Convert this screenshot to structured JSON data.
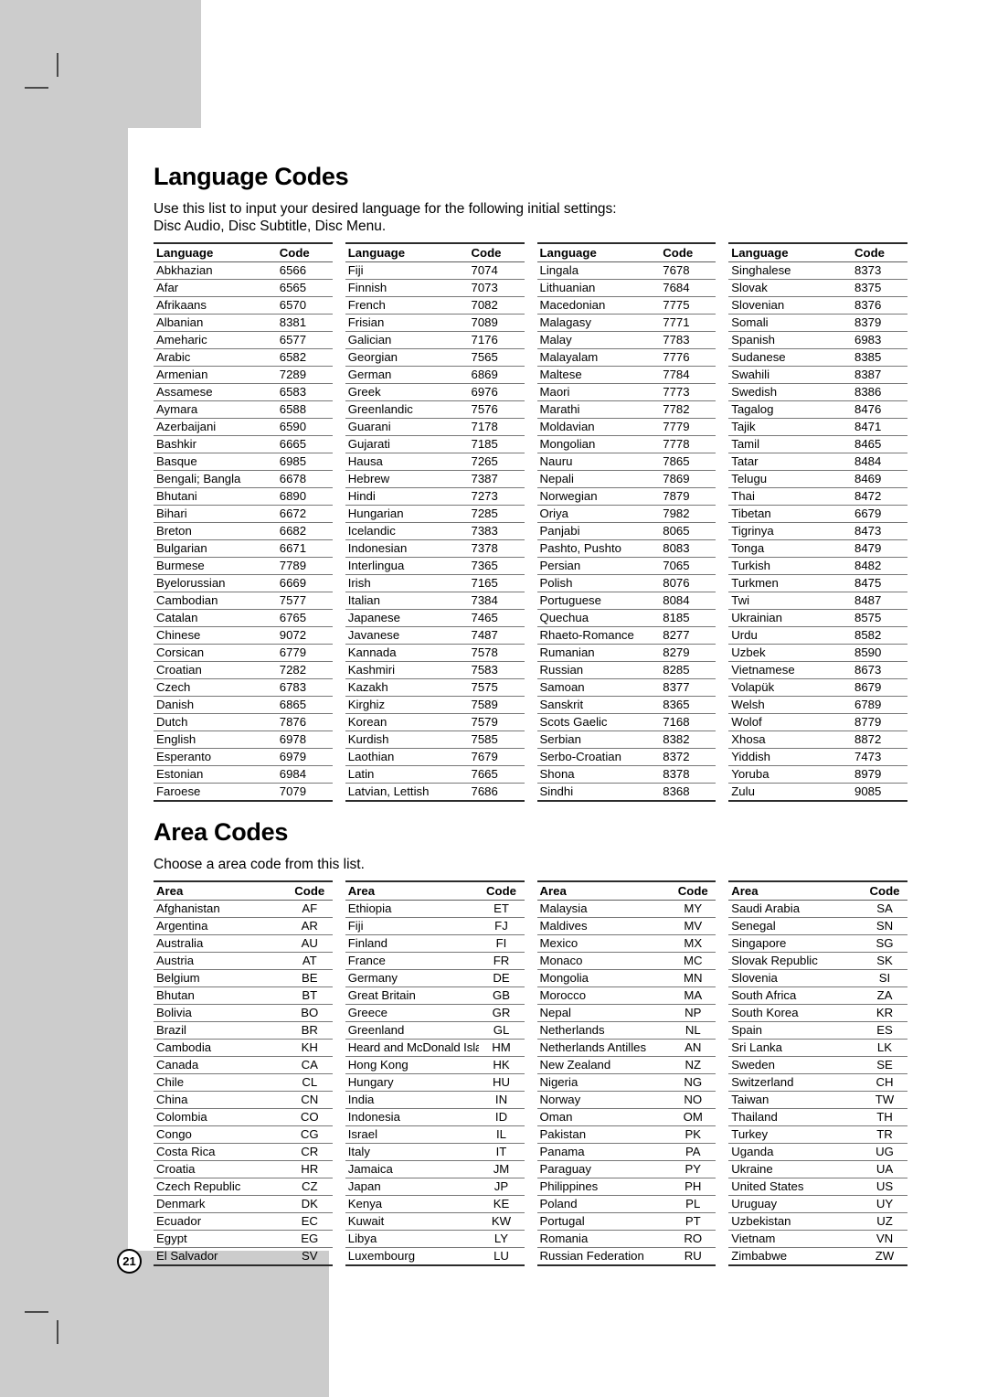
{
  "page": {
    "number": "21"
  },
  "language_section": {
    "title": "Language Codes",
    "intro_line1": "Use this list to input your desired language for the following initial settings:",
    "intro_line2": "Disc Audio, Disc Subtitle, Disc Menu.",
    "headers": {
      "name": "Language",
      "code": "Code"
    },
    "columns": [
      [
        [
          "Abkhazian",
          "6566"
        ],
        [
          "Afar",
          "6565"
        ],
        [
          "Afrikaans",
          "6570"
        ],
        [
          "Albanian",
          "8381"
        ],
        [
          "Ameharic",
          "6577"
        ],
        [
          "Arabic",
          "6582"
        ],
        [
          "Armenian",
          "7289"
        ],
        [
          "Assamese",
          "6583"
        ],
        [
          "Aymara",
          "6588"
        ],
        [
          "Azerbaijani",
          "6590"
        ],
        [
          "Bashkir",
          "6665"
        ],
        [
          "Basque",
          "6985"
        ],
        [
          "Bengali; Bangla",
          "6678"
        ],
        [
          "Bhutani",
          "6890"
        ],
        [
          "Bihari",
          "6672"
        ],
        [
          "Breton",
          "6682"
        ],
        [
          "Bulgarian",
          "6671"
        ],
        [
          "Burmese",
          "7789"
        ],
        [
          "Byelorussian",
          "6669"
        ],
        [
          "Cambodian",
          "7577"
        ],
        [
          "Catalan",
          "6765"
        ],
        [
          "Chinese",
          "9072"
        ],
        [
          "Corsican",
          "6779"
        ],
        [
          "Croatian",
          "7282"
        ],
        [
          "Czech",
          "6783"
        ],
        [
          "Danish",
          "6865"
        ],
        [
          "Dutch",
          "7876"
        ],
        [
          "English",
          "6978"
        ],
        [
          "Esperanto",
          "6979"
        ],
        [
          "Estonian",
          "6984"
        ],
        [
          "Faroese",
          "7079"
        ]
      ],
      [
        [
          "Fiji",
          "7074"
        ],
        [
          "Finnish",
          "7073"
        ],
        [
          "French",
          "7082"
        ],
        [
          "Frisian",
          "7089"
        ],
        [
          "Galician",
          "7176"
        ],
        [
          "Georgian",
          "7565"
        ],
        [
          "German",
          "6869"
        ],
        [
          "Greek",
          "6976"
        ],
        [
          "Greenlandic",
          "7576"
        ],
        [
          "Guarani",
          "7178"
        ],
        [
          "Gujarati",
          "7185"
        ],
        [
          "Hausa",
          "7265"
        ],
        [
          "Hebrew",
          "7387"
        ],
        [
          "Hindi",
          "7273"
        ],
        [
          "Hungarian",
          "7285"
        ],
        [
          "Icelandic",
          "7383"
        ],
        [
          "Indonesian",
          "7378"
        ],
        [
          "Interlingua",
          "7365"
        ],
        [
          "Irish",
          "7165"
        ],
        [
          "Italian",
          "7384"
        ],
        [
          "Japanese",
          "7465"
        ],
        [
          "Javanese",
          "7487"
        ],
        [
          "Kannada",
          "7578"
        ],
        [
          "Kashmiri",
          "7583"
        ],
        [
          "Kazakh",
          "7575"
        ],
        [
          "Kirghiz",
          "7589"
        ],
        [
          "Korean",
          "7579"
        ],
        [
          "Kurdish",
          "7585"
        ],
        [
          "Laothian",
          "7679"
        ],
        [
          "Latin",
          "7665"
        ],
        [
          "Latvian, Lettish",
          "7686"
        ]
      ],
      [
        [
          "Lingala",
          "7678"
        ],
        [
          "Lithuanian",
          "7684"
        ],
        [
          "Macedonian",
          "7775"
        ],
        [
          "Malagasy",
          "7771"
        ],
        [
          "Malay",
          "7783"
        ],
        [
          "Malayalam",
          "7776"
        ],
        [
          "Maltese",
          "7784"
        ],
        [
          "Maori",
          "7773"
        ],
        [
          "Marathi",
          "7782"
        ],
        [
          "Moldavian",
          "7779"
        ],
        [
          "Mongolian",
          "7778"
        ],
        [
          "Nauru",
          "7865"
        ],
        [
          "Nepali",
          "7869"
        ],
        [
          "Norwegian",
          "7879"
        ],
        [
          "Oriya",
          "7982"
        ],
        [
          "Panjabi",
          "8065"
        ],
        [
          "Pashto, Pushto",
          "8083"
        ],
        [
          "Persian",
          "7065"
        ],
        [
          "Polish",
          "8076"
        ],
        [
          "Portuguese",
          "8084"
        ],
        [
          "Quechua",
          "8185"
        ],
        [
          "Rhaeto-Romance",
          "8277"
        ],
        [
          "Rumanian",
          "8279"
        ],
        [
          "Russian",
          "8285"
        ],
        [
          "Samoan",
          "8377"
        ],
        [
          "Sanskrit",
          "8365"
        ],
        [
          "Scots Gaelic",
          "7168"
        ],
        [
          "Serbian",
          "8382"
        ],
        [
          "Serbo-Croatian",
          "8372"
        ],
        [
          "Shona",
          "8378"
        ],
        [
          "Sindhi",
          "8368"
        ]
      ],
      [
        [
          "Singhalese",
          "8373"
        ],
        [
          "Slovak",
          "8375"
        ],
        [
          "Slovenian",
          "8376"
        ],
        [
          "Somali",
          "8379"
        ],
        [
          "Spanish",
          "6983"
        ],
        [
          "Sudanese",
          "8385"
        ],
        [
          "Swahili",
          "8387"
        ],
        [
          "Swedish",
          "8386"
        ],
        [
          "Tagalog",
          "8476"
        ],
        [
          "Tajik",
          "8471"
        ],
        [
          "Tamil",
          "8465"
        ],
        [
          "Tatar",
          "8484"
        ],
        [
          "Telugu",
          "8469"
        ],
        [
          "Thai",
          "8472"
        ],
        [
          "Tibetan",
          "6679"
        ],
        [
          "Tigrinya",
          "8473"
        ],
        [
          "Tonga",
          "8479"
        ],
        [
          "Turkish",
          "8482"
        ],
        [
          "Turkmen",
          "8475"
        ],
        [
          "Twi",
          "8487"
        ],
        [
          "Ukrainian",
          "8575"
        ],
        [
          "Urdu",
          "8582"
        ],
        [
          "Uzbek",
          "8590"
        ],
        [
          "Vietnamese",
          "8673"
        ],
        [
          "Volapük",
          "8679"
        ],
        [
          "Welsh",
          "6789"
        ],
        [
          "Wolof",
          "8779"
        ],
        [
          "Xhosa",
          "8872"
        ],
        [
          "Yiddish",
          "7473"
        ],
        [
          "Yoruba",
          "8979"
        ],
        [
          "Zulu",
          "9085"
        ]
      ]
    ]
  },
  "area_section": {
    "title": "Area Codes",
    "intro_line1": "Choose a area code from this list.",
    "headers": {
      "name": "Area",
      "code": "Code"
    },
    "columns": [
      [
        [
          "Afghanistan",
          "AF"
        ],
        [
          "Argentina",
          "AR"
        ],
        [
          "Australia",
          "AU"
        ],
        [
          "Austria",
          "AT"
        ],
        [
          "Belgium",
          "BE"
        ],
        [
          "Bhutan",
          "BT"
        ],
        [
          "Bolivia",
          "BO"
        ],
        [
          "Brazil",
          "BR"
        ],
        [
          "Cambodia",
          "KH"
        ],
        [
          "Canada",
          "CA"
        ],
        [
          "Chile",
          "CL"
        ],
        [
          "China",
          "CN"
        ],
        [
          "Colombia",
          "CO"
        ],
        [
          "Congo",
          "CG"
        ],
        [
          "Costa Rica",
          "CR"
        ],
        [
          "Croatia",
          "HR"
        ],
        [
          "Czech Republic",
          "CZ"
        ],
        [
          "Denmark",
          "DK"
        ],
        [
          "Ecuador",
          "EC"
        ],
        [
          "Egypt",
          "EG"
        ],
        [
          "El Salvador",
          "SV"
        ]
      ],
      [
        [
          "Ethiopia",
          "ET"
        ],
        [
          "Fiji",
          "FJ"
        ],
        [
          "Finland",
          "FI"
        ],
        [
          "France",
          "FR"
        ],
        [
          "Germany",
          "DE"
        ],
        [
          "Great Britain",
          "GB"
        ],
        [
          "Greece",
          "GR"
        ],
        [
          "Greenland",
          "GL"
        ],
        [
          "Heard and McDonald Islands",
          "HM"
        ],
        [
          "Hong Kong",
          "HK"
        ],
        [
          "Hungary",
          "HU"
        ],
        [
          "India",
          "IN"
        ],
        [
          "Indonesia",
          "ID"
        ],
        [
          "Israel",
          "IL"
        ],
        [
          "Italy",
          "IT"
        ],
        [
          "Jamaica",
          "JM"
        ],
        [
          "Japan",
          "JP"
        ],
        [
          "Kenya",
          "KE"
        ],
        [
          "Kuwait",
          "KW"
        ],
        [
          "Libya",
          "LY"
        ],
        [
          "Luxembourg",
          "LU"
        ]
      ],
      [
        [
          "Malaysia",
          "MY"
        ],
        [
          "Maldives",
          "MV"
        ],
        [
          "Mexico",
          "MX"
        ],
        [
          "Monaco",
          "MC"
        ],
        [
          "Mongolia",
          "MN"
        ],
        [
          "Morocco",
          "MA"
        ],
        [
          "Nepal",
          "NP"
        ],
        [
          "Netherlands",
          "NL"
        ],
        [
          "Netherlands Antilles",
          "AN"
        ],
        [
          "New Zealand",
          "NZ"
        ],
        [
          "Nigeria",
          "NG"
        ],
        [
          "Norway",
          "NO"
        ],
        [
          "Oman",
          "OM"
        ],
        [
          "Pakistan",
          "PK"
        ],
        [
          "Panama",
          "PA"
        ],
        [
          "Paraguay",
          "PY"
        ],
        [
          "Philippines",
          "PH"
        ],
        [
          "Poland",
          "PL"
        ],
        [
          "Portugal",
          "PT"
        ],
        [
          "Romania",
          "RO"
        ],
        [
          "Russian Federation",
          "RU"
        ]
      ],
      [
        [
          "Saudi Arabia",
          "SA"
        ],
        [
          "Senegal",
          "SN"
        ],
        [
          "Singapore",
          "SG"
        ],
        [
          "Slovak Republic",
          "SK"
        ],
        [
          "Slovenia",
          "SI"
        ],
        [
          "South Africa",
          "ZA"
        ],
        [
          "South Korea",
          "KR"
        ],
        [
          "Spain",
          "ES"
        ],
        [
          "Sri Lanka",
          "LK"
        ],
        [
          "Sweden",
          "SE"
        ],
        [
          "Switzerland",
          "CH"
        ],
        [
          "Taiwan",
          "TW"
        ],
        [
          "Thailand",
          "TH"
        ],
        [
          "Turkey",
          "TR"
        ],
        [
          "Uganda",
          "UG"
        ],
        [
          "Ukraine",
          "UA"
        ],
        [
          "United States",
          "US"
        ],
        [
          "Uruguay",
          "UY"
        ],
        [
          "Uzbekistan",
          "UZ"
        ],
        [
          "Vietnam",
          "VN"
        ],
        [
          "Zimbabwe",
          "ZW"
        ]
      ]
    ]
  }
}
